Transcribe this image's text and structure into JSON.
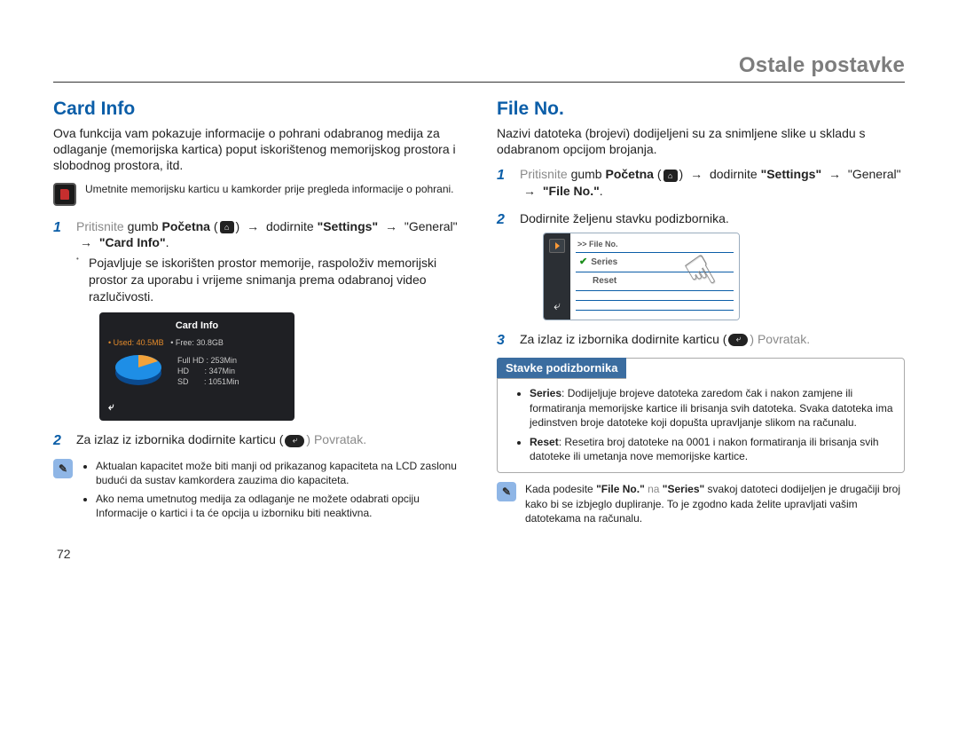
{
  "chapter": "Ostale postavke",
  "pageNumber": "72",
  "left": {
    "title": "Card Info",
    "intro": "Ova funkcija vam pokazuje informacije o pohrani odabranog medija za odlaganje (memorijska kartica) poput iskorištenog memorijskog prostora i slobodnog prostora, itd.",
    "insertNote": "Umetnite memorijsku karticu u kamkorder prije pregleda informacije o pohrani.",
    "step1_pritisnite": "Pritisnite",
    "step1_gumb": " gumb ",
    "step1_pocetna": "Početna",
    "step1_dodirnite": " dodirnite ",
    "step1_settings": "\"Settings\"",
    "step1_general": "\"General\"",
    "step1_last": "\"Card Info\"",
    "step1_bullet": "Pojavljuje se iskorišten prostor memorije, raspoloživ memorijski prostor za uporabu i vrijeme snimanja prema odabranoj video razlučivosti.",
    "step2_a": "Za izlaz iz izbornika dodirnite karticu (",
    "step2_b": ") Povratak.",
    "chart_data": {
      "type": "pie",
      "title": "Card Info",
      "used_label": "Used: 40.5MB",
      "free_label": "Free: 30.8GB",
      "rows": [
        {
          "label": "Full HD",
          "value": "253Min"
        },
        {
          "label": "HD",
          "value": "347Min"
        },
        {
          "label": "SD",
          "value": "1051Min"
        }
      ],
      "used_fraction": 0.04
    },
    "noteItems": [
      "Aktualan kapacitet može biti manji od prikazanog kapaciteta na LCD zaslonu budući da sustav kamkordera zauzima dio kapaciteta.",
      "Ako nema umetnutog medija za odlaganje ne možete odabrati opciju Informacije o kartici i ta će opcija u izborniku biti neaktivna."
    ]
  },
  "right": {
    "title": "File No.",
    "intro": "Nazivi datoteka (brojevi) dodijeljeni su za snimljene slike u skladu s odabranom opcijom brojanja.",
    "step1_pritisnite": "Pritisnite",
    "step1_gumb": " gumb ",
    "step1_pocetna": "Početna",
    "step1_dodirnite": " dodirnite ",
    "step1_settings": "\"Settings\"",
    "step1_general": "\"General\"",
    "step1_last": "\"File No.\"",
    "step2": "Dodirnite željenu stavku podizbornika.",
    "step3_a": "Za izlaz iz izbornika dodirnite karticu (",
    "step3_b": ") Povratak.",
    "fn_header": ">> File No.",
    "fn_row1": "Series",
    "fn_row2": "Reset",
    "panelHeader": "Stavke podizbornika",
    "panel": {
      "series_label": "Series",
      "series_text": ": Dodijeljuje brojeve datoteka zaredom čak i nakon zamjene ili formatiranja memorijske kartice ili brisanja svih datoteka. Svaka datoteka ima jedinstven broje datoteke koji dopušta upravljanje slikom na računalu.",
      "reset_label": "Reset",
      "reset_text": ": Resetira broj datoteke na 0001 i nakon formatiranja ili brisanja svih datoteke ili umetanja nove memorijske kartice."
    },
    "noteText_a": "Kada podesite ",
    "noteText_b": "\"File No.\"",
    "noteText_c": " na ",
    "noteText_d": "\"Series\"",
    "noteText_e": " svakoj datoteci dodijeljen je drugačiji broj kako bi se izbjeglo dupliranje. To je zgodno kada želite upravljati vašim datotekama na računalu."
  }
}
